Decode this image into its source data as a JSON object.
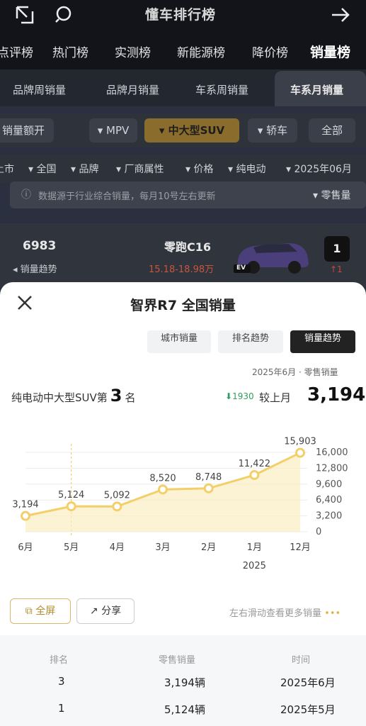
{
  "header": {
    "title": "懂车排行榜",
    "category_tabs": [
      "点评榜",
      "热门榜",
      "实测榜",
      "新能源榜",
      "降价榜",
      "销量榜"
    ],
    "active_category": "销量榜"
  },
  "sub_tabs": [
    "品牌周销量",
    "品牌月销量",
    "车系周销量",
    "车系月销量"
  ],
  "active_sub_tab": "车系月销量",
  "filters": {
    "chips": [
      "销量额开",
      "MPV",
      "中大型SUV",
      "轿车",
      "全部"
    ],
    "selected": "中大型SUV",
    "secondary": [
      "上市",
      "全国",
      "品牌",
      "厂商属性",
      "价格",
      "纯电动",
      "2025年06月"
    ]
  },
  "notice": {
    "text": "数据源于行业综合销量，每月10号左右更新",
    "sort_label": "零售量"
  },
  "list_row": {
    "rank": "1",
    "trend": "↑1",
    "name": "零跑C16",
    "price": "15.18-18.98万",
    "sales": "6983",
    "trend_label": "销量趋势",
    "badge": "EV"
  },
  "sheet": {
    "title": "智界R7 全国销量",
    "segments": [
      "城市销量",
      "排名趋势",
      "销量趋势"
    ],
    "active_segment": "销量趋势",
    "meta": "2025年6月 · 零售销量",
    "value": "3,194",
    "compare_label": "较上月",
    "compare_delta": "1930",
    "rank_prefix": "纯电动中大型SUV第",
    "rank_number": "3",
    "rank_suffix": "名",
    "buttons": {
      "fullscreen": "全屏",
      "share": "分享"
    },
    "swipe_hint": "左右滑动查看更多销量",
    "table": {
      "headers": [
        "时间",
        "零售销量",
        "排名"
      ],
      "rows": [
        [
          "2025年6月",
          "3,194辆",
          "3"
        ],
        [
          "2025年5月",
          "5,124辆",
          "1"
        ]
      ]
    }
  },
  "chart_data": {
    "type": "line",
    "categories": [
      "12月",
      "1月",
      "2月",
      "3月",
      "4月",
      "5月",
      "6月"
    ],
    "values": [
      15903,
      11422,
      8748,
      8520,
      5092,
      5124,
      3194
    ],
    "value_labels": [
      "15,903",
      "11,422",
      "8,748",
      "8,520",
      "5,092",
      "5,124",
      "3,194"
    ],
    "y_ticks": [
      "16,000",
      "12,800",
      "9,600",
      "6,400",
      "3,200",
      "0"
    ],
    "ylim": [
      0,
      16000
    ],
    "year_label": "2025",
    "grid": true,
    "colors": {
      "line": "#f3cf6a",
      "fill": "#fbecc2",
      "point": "#f3cf6a"
    }
  }
}
